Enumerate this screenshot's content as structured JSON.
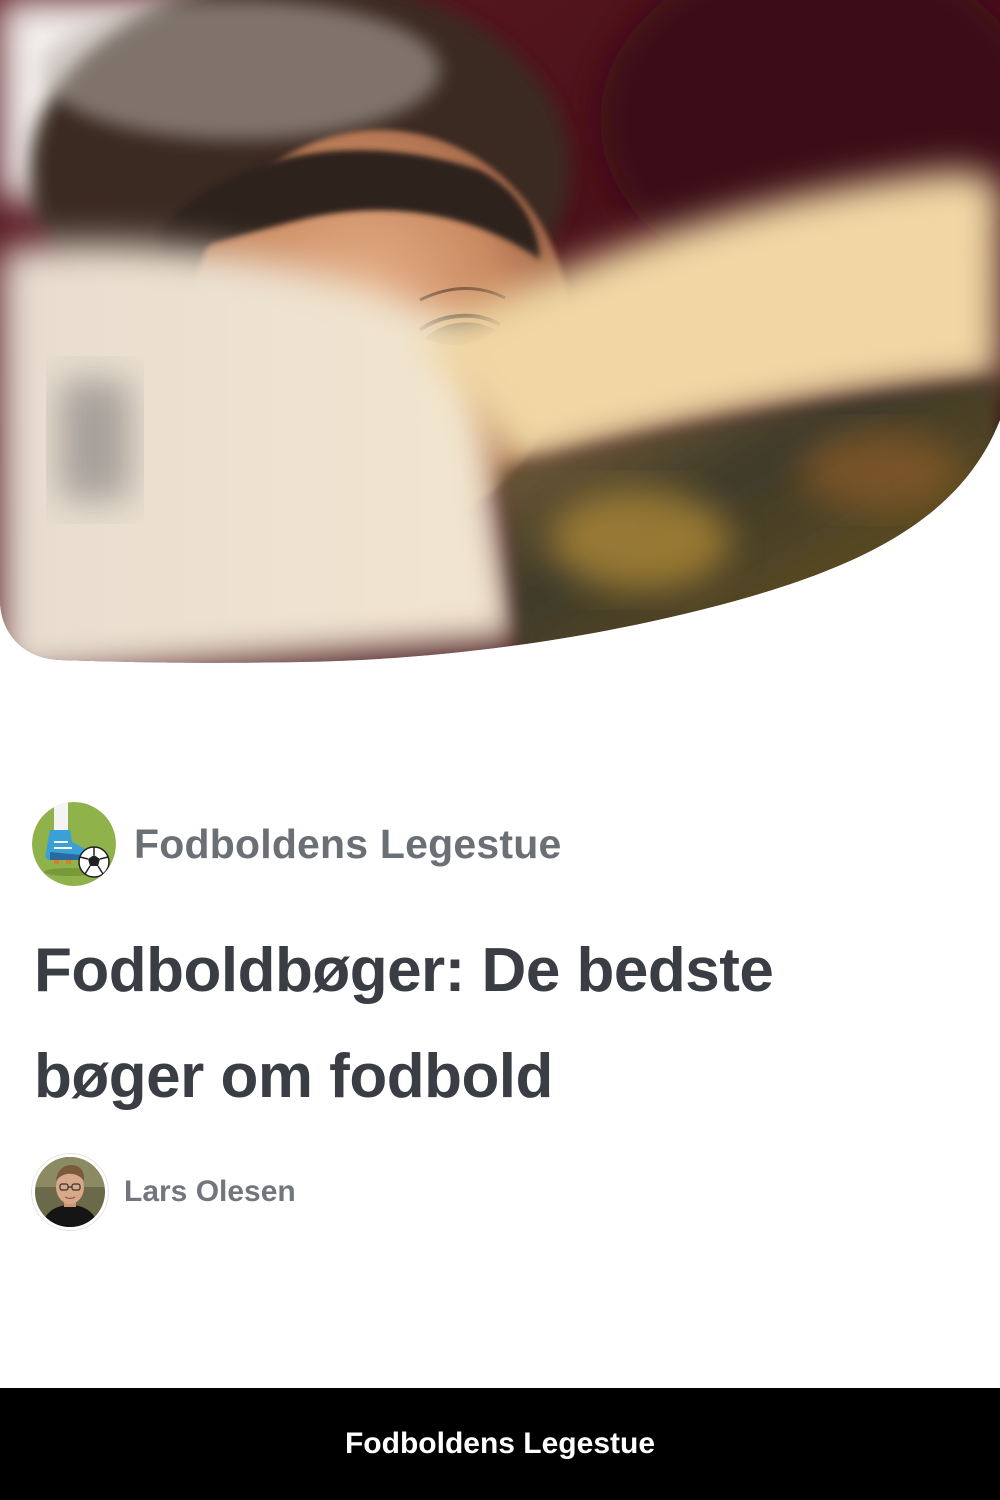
{
  "hero": {
    "image_subject": "child-reading-book-photo"
  },
  "site": {
    "name": "Fodboldens Legestue",
    "logo_icon": "soccer-boot-kicking-ball-icon",
    "logo_bg": "#8fb24a"
  },
  "article": {
    "title": "Fodboldbøger: De bedste bøger om fodbold"
  },
  "author": {
    "name": "Lars Olesen",
    "avatar_icon": "author-portrait-icon"
  },
  "footer": {
    "label": "Fodboldens Legestue"
  },
  "colors": {
    "title_text": "#3a3e44",
    "muted_text": "#6b7077",
    "footer_bg": "#000000",
    "footer_text": "#ffffff"
  }
}
